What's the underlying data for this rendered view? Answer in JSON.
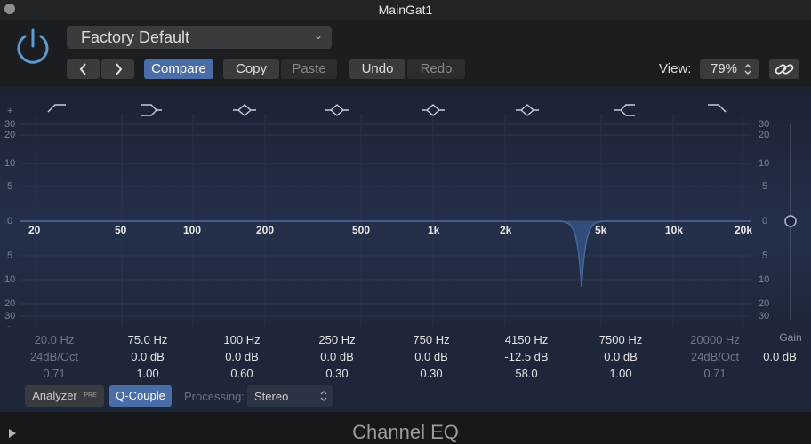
{
  "window": {
    "title": "MainGat1"
  },
  "header": {
    "preset": "Factory Default",
    "compare_label": "Compare",
    "copy_label": "Copy",
    "paste_label": "Paste",
    "undo_label": "Undo",
    "redo_label": "Redo",
    "view_label": "View:",
    "view_value": "79%"
  },
  "graph": {
    "db_ticks_left": [
      "+",
      "30",
      "20",
      "10",
      "5",
      "0",
      "5",
      "10",
      "20",
      "30",
      "-"
    ],
    "db_ticks_right": [
      "30",
      "20",
      "10",
      "5",
      "0",
      "5",
      "10",
      "20",
      "30"
    ],
    "freq_labels": [
      "20",
      "50",
      "100",
      "200",
      "500",
      "1k",
      "2k",
      "5k",
      "10k",
      "20k"
    ]
  },
  "bands": [
    {
      "freq": "20.0 Hz",
      "gain": "24dB/Oct",
      "q": "0.71",
      "enabled": false
    },
    {
      "freq": "75.0 Hz",
      "gain": "0.0 dB",
      "q": "1.00",
      "enabled": true
    },
    {
      "freq": "100 Hz",
      "gain": "0.0 dB",
      "q": "0.60",
      "enabled": true
    },
    {
      "freq": "250 Hz",
      "gain": "0.0 dB",
      "q": "0.30",
      "enabled": true
    },
    {
      "freq": "750 Hz",
      "gain": "0.0 dB",
      "q": "0.30",
      "enabled": true
    },
    {
      "freq": "4150 Hz",
      "gain": "-12.5 dB",
      "q": "58.0",
      "enabled": true
    },
    {
      "freq": "7500 Hz",
      "gain": "0.0 dB",
      "q": "1.00",
      "enabled": true
    },
    {
      "freq": "20000 Hz",
      "gain": "24dB/Oct",
      "q": "0.71",
      "enabled": false
    }
  ],
  "gain": {
    "label": "Gain",
    "value": "0.0 dB"
  },
  "footer": {
    "analyzer_label": "Analyzer",
    "analyzer_badge": "PRE",
    "qcouple_label": "Q-Couple",
    "processing_label": "Processing:",
    "processing_value": "Stereo",
    "plugin_name": "Channel EQ"
  },
  "colors": {
    "accent": "#4a6da8",
    "power": "#5b9bd5",
    "curve": "#3a5a90"
  }
}
